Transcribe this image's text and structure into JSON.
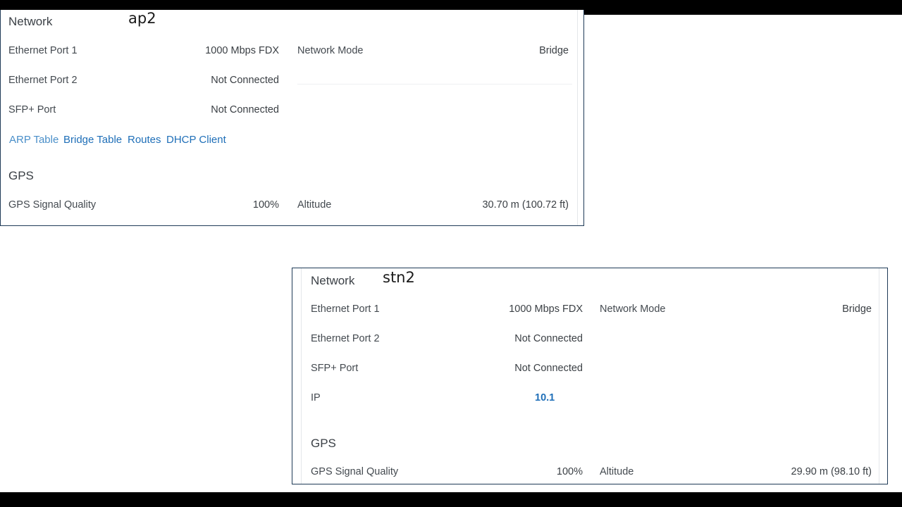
{
  "ap2": {
    "device_label": "ap2",
    "network": {
      "title": "Network",
      "ethernet_port_1": {
        "label": "Ethernet Port 1",
        "value": "1000 Mbps FDX"
      },
      "network_mode": {
        "label": "Network Mode",
        "value": "Bridge"
      },
      "ethernet_port_2": {
        "label": "Ethernet Port 2",
        "value": "Not Connected"
      },
      "sfp_port": {
        "label": "SFP+ Port",
        "value": "Not Connected"
      },
      "links": [
        "ARP Table",
        "Bridge Table",
        "Routes",
        "DHCP Client"
      ]
    },
    "gps": {
      "title": "GPS",
      "signal_quality": {
        "label": "GPS Signal Quality",
        "value": "100%"
      },
      "altitude": {
        "label": "Altitude",
        "value": "30.70 m (100.72 ft)"
      }
    }
  },
  "stn2": {
    "device_label": "stn2",
    "network": {
      "title": "Network",
      "ethernet_port_1": {
        "label": "Ethernet Port 1",
        "value": "1000 Mbps FDX"
      },
      "network_mode": {
        "label": "Network Mode",
        "value": "Bridge"
      },
      "ethernet_port_2": {
        "label": "Ethernet Port 2",
        "value": "Not Connected"
      },
      "sfp_port": {
        "label": "SFP+ Port",
        "value": "Not Connected"
      },
      "ip": {
        "label": "IP",
        "value": "10.1"
      }
    },
    "gps": {
      "title": "GPS",
      "signal_quality": {
        "label": "GPS Signal Quality",
        "value": "100%"
      },
      "altitude": {
        "label": "Altitude",
        "value": "29.90 m (98.10 ft)"
      }
    }
  },
  "colors": {
    "link": "#1f6fb8",
    "panel_border": "#1f3b57",
    "frame": "#000000"
  }
}
